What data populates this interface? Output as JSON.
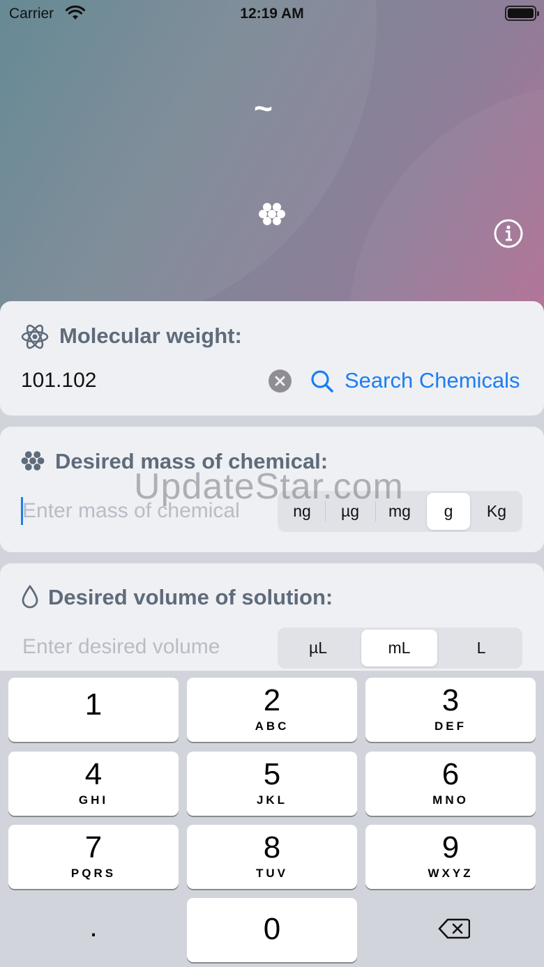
{
  "status_bar": {
    "carrier": "Carrier",
    "time": "12:19 AM"
  },
  "header": {
    "tilde": "~"
  },
  "molecular_weight": {
    "title": "Molecular weight:",
    "value": "101.102",
    "search_label": "Search Chemicals"
  },
  "mass": {
    "title": "Desired mass of chemical:",
    "placeholder": "Enter mass of chemical",
    "units": [
      "ng",
      "µg",
      "mg",
      "g",
      "Kg"
    ],
    "selected_unit": "g"
  },
  "volume": {
    "title": "Desired volume of solution:",
    "placeholder": "Enter desired volume",
    "units": [
      "µL",
      "mL",
      "L"
    ],
    "selected_unit": "mL"
  },
  "watermark": "UpdateStar.com",
  "keyboard": {
    "keys": [
      {
        "num": "1",
        "letters": ""
      },
      {
        "num": "2",
        "letters": "ABC"
      },
      {
        "num": "3",
        "letters": "DEF"
      },
      {
        "num": "4",
        "letters": "GHI"
      },
      {
        "num": "5",
        "letters": "JKL"
      },
      {
        "num": "6",
        "letters": "MNO"
      },
      {
        "num": "7",
        "letters": "PQRS"
      },
      {
        "num": "8",
        "letters": "TUV"
      },
      {
        "num": "9",
        "letters": "WXYZ"
      },
      {
        "num": "0",
        "letters": ""
      }
    ],
    "decimal": "."
  },
  "colors": {
    "accent": "#1b7ef2",
    "title_gray": "#5e6b7a",
    "card_bg": "#eff0f4",
    "keyboard_bg": "#d1d4da"
  },
  "icons": {
    "status_wifi": "wifi-icon",
    "header_dots": "cluster-dots-icon",
    "header_info": "info-icon",
    "mw": "atom-icon",
    "mass": "cluster-dots-icon",
    "volume": "drop-icon",
    "clear": "clear-icon",
    "search": "search-icon",
    "backspace": "backspace-icon"
  }
}
